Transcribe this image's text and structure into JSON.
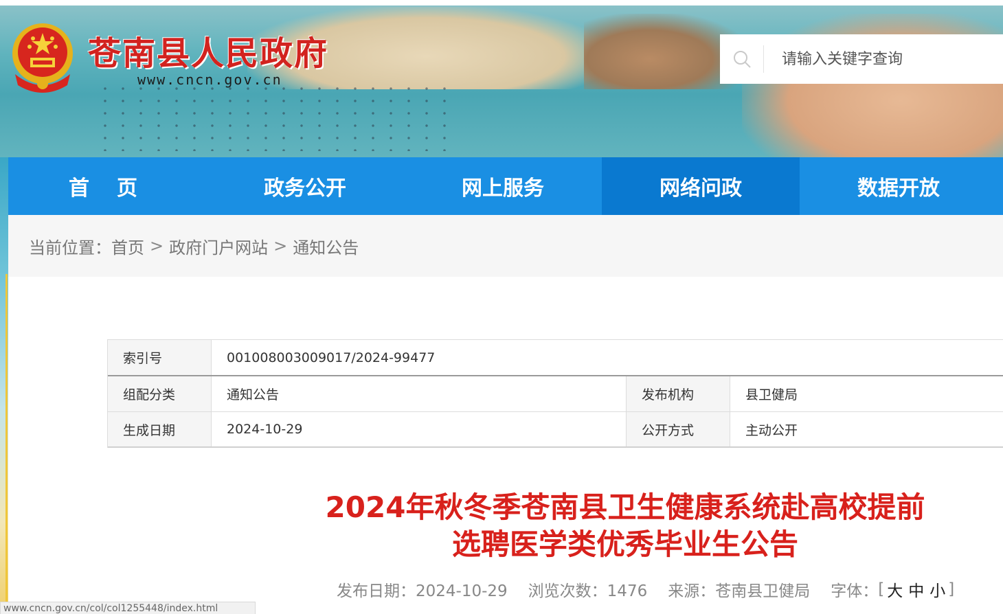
{
  "header": {
    "site_name": "苍南县人民政府",
    "site_url": "www.cncn.gov.cn",
    "search_placeholder": "请输入关键字查询"
  },
  "nav": {
    "items": [
      "首页",
      "政务公开",
      "网上服务",
      "网络问政",
      "数据开放"
    ],
    "active": "网络问政"
  },
  "breadcrumb": {
    "prefix": "当前位置：",
    "items": [
      "首页",
      "政府门户网站",
      "通知公告"
    ],
    "separator": ">"
  },
  "meta": {
    "index_label": "索引号",
    "index_value": "001008003009017/2024-99477",
    "category_label": "组配分类",
    "category_value": "通知公告",
    "publisher_label": "发布机构",
    "publisher_value": "县卫健局",
    "date_label": "生成日期",
    "date_value": "2024-10-29",
    "open_label": "公开方式",
    "open_value": "主动公开"
  },
  "article": {
    "title_line1": "2024年秋冬季苍南县卫生健康系统赴高校提前",
    "title_line2": "选聘医学类优秀毕业生公告",
    "publish_date": "发布日期：2024-10-29",
    "views": "浏览次数：1476",
    "source": "来源：苍南县卫健局",
    "font_label": "字体：",
    "bracket_open": "[",
    "font_large": "大",
    "font_medium": "中",
    "font_small": "小",
    "bracket_close": "]"
  },
  "status_bar": {
    "url": "www.cncn.gov.cn/col/col1255448/index.html"
  },
  "colors": {
    "nav_bg": "#1a8fe3",
    "nav_active": "#0a79d0",
    "title_red": "#d8211c",
    "brand_red": "#d2231f"
  }
}
